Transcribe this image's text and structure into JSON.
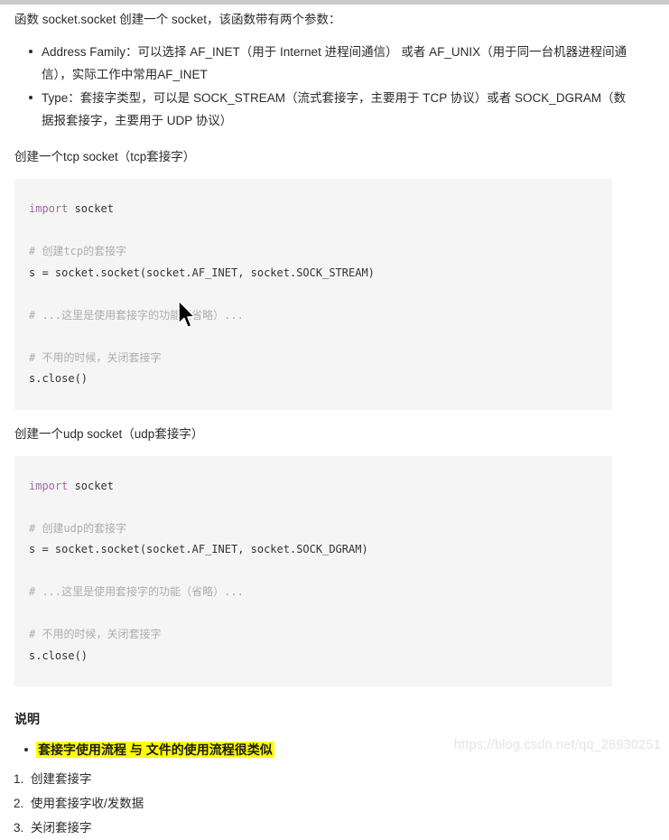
{
  "document": {
    "intro_paragraph": "函数 socket.socket 创建一个 socket，该函数带有两个参数：",
    "param_bullets": [
      "Address Family：可以选择 AF_INET（用于 Internet 进程间通信） 或者 AF_UNIX（用于同一台机器进程间通信），实际工作中常用AF_INET",
      "Type：套接字类型，可以是 SOCK_STREAM（流式套接字，主要用于 TCP 协议）或者 SOCK_DGRAM（数据报套接字，主要用于 UDP 协议）"
    ],
    "tcp_section": {
      "label": "创建一个tcp socket（tcp套接字）",
      "code": {
        "line1_kw": "import",
        "line1_rest": " socket",
        "comment1": "# 创建tcp的套接字",
        "line2": "s = socket.socket(socket.AF_INET, socket.SOCK_STREAM)",
        "comment2": "# ...这里是使用套接字的功能（省略）...",
        "comment3": "# 不用的时候，关闭套接字",
        "line3": "s.close()"
      }
    },
    "udp_section": {
      "label": "创建一个udp socket（udp套接字）",
      "code": {
        "line1_kw": "import",
        "line1_rest": " socket",
        "comment1": "# 创建udp的套接字",
        "line2": "s = socket.socket(socket.AF_INET, socket.SOCK_DGRAM)",
        "comment2": "# ...这里是使用套接字的功能（省略）...",
        "comment3": "# 不用的时候，关闭套接字",
        "line3": "s.close()"
      }
    },
    "explain_section": {
      "heading": "说明",
      "highlighted_note": "套接字使用流程 与 文件的使用流程很类似",
      "steps": [
        "创建套接字",
        "使用套接字收/发数据",
        "关闭套接字"
      ]
    },
    "watermark": "https://blog.csdn.net/qq_28930251"
  },
  "colors": {
    "page_background": "#ffffff",
    "code_background": "#f5f5f5",
    "keyword": "#a06ba6",
    "comment": "#adadad",
    "highlight": "#ffff00",
    "text": "#2b2b2b",
    "watermark": "#e4e4e4",
    "top_strip": "#c9c9c9"
  }
}
